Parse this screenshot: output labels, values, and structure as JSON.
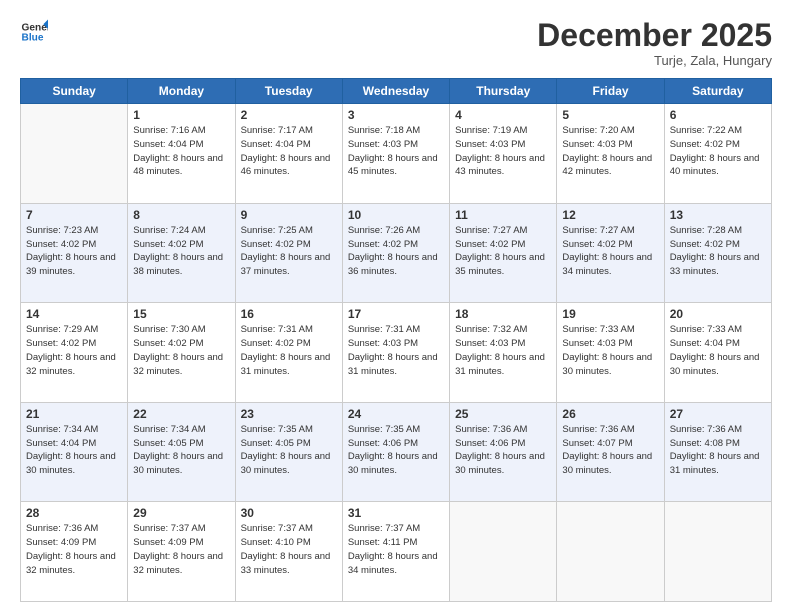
{
  "header": {
    "logo_line1": "General",
    "logo_line2": "Blue",
    "month": "December 2025",
    "location": "Turje, Zala, Hungary"
  },
  "weekdays": [
    "Sunday",
    "Monday",
    "Tuesday",
    "Wednesday",
    "Thursday",
    "Friday",
    "Saturday"
  ],
  "weeks": [
    [
      {
        "day": "",
        "sunrise": "",
        "sunset": "",
        "daylight": ""
      },
      {
        "day": "1",
        "sunrise": "7:16 AM",
        "sunset": "4:04 PM",
        "daylight": "8 hours and 48 minutes."
      },
      {
        "day": "2",
        "sunrise": "7:17 AM",
        "sunset": "4:04 PM",
        "daylight": "8 hours and 46 minutes."
      },
      {
        "day": "3",
        "sunrise": "7:18 AM",
        "sunset": "4:03 PM",
        "daylight": "8 hours and 45 minutes."
      },
      {
        "day": "4",
        "sunrise": "7:19 AM",
        "sunset": "4:03 PM",
        "daylight": "8 hours and 43 minutes."
      },
      {
        "day": "5",
        "sunrise": "7:20 AM",
        "sunset": "4:03 PM",
        "daylight": "8 hours and 42 minutes."
      },
      {
        "day": "6",
        "sunrise": "7:22 AM",
        "sunset": "4:02 PM",
        "daylight": "8 hours and 40 minutes."
      }
    ],
    [
      {
        "day": "7",
        "sunrise": "7:23 AM",
        "sunset": "4:02 PM",
        "daylight": "8 hours and 39 minutes."
      },
      {
        "day": "8",
        "sunrise": "7:24 AM",
        "sunset": "4:02 PM",
        "daylight": "8 hours and 38 minutes."
      },
      {
        "day": "9",
        "sunrise": "7:25 AM",
        "sunset": "4:02 PM",
        "daylight": "8 hours and 37 minutes."
      },
      {
        "day": "10",
        "sunrise": "7:26 AM",
        "sunset": "4:02 PM",
        "daylight": "8 hours and 36 minutes."
      },
      {
        "day": "11",
        "sunrise": "7:27 AM",
        "sunset": "4:02 PM",
        "daylight": "8 hours and 35 minutes."
      },
      {
        "day": "12",
        "sunrise": "7:27 AM",
        "sunset": "4:02 PM",
        "daylight": "8 hours and 34 minutes."
      },
      {
        "day": "13",
        "sunrise": "7:28 AM",
        "sunset": "4:02 PM",
        "daylight": "8 hours and 33 minutes."
      }
    ],
    [
      {
        "day": "14",
        "sunrise": "7:29 AM",
        "sunset": "4:02 PM",
        "daylight": "8 hours and 32 minutes."
      },
      {
        "day": "15",
        "sunrise": "7:30 AM",
        "sunset": "4:02 PM",
        "daylight": "8 hours and 32 minutes."
      },
      {
        "day": "16",
        "sunrise": "7:31 AM",
        "sunset": "4:02 PM",
        "daylight": "8 hours and 31 minutes."
      },
      {
        "day": "17",
        "sunrise": "7:31 AM",
        "sunset": "4:03 PM",
        "daylight": "8 hours and 31 minutes."
      },
      {
        "day": "18",
        "sunrise": "7:32 AM",
        "sunset": "4:03 PM",
        "daylight": "8 hours and 31 minutes."
      },
      {
        "day": "19",
        "sunrise": "7:33 AM",
        "sunset": "4:03 PM",
        "daylight": "8 hours and 30 minutes."
      },
      {
        "day": "20",
        "sunrise": "7:33 AM",
        "sunset": "4:04 PM",
        "daylight": "8 hours and 30 minutes."
      }
    ],
    [
      {
        "day": "21",
        "sunrise": "7:34 AM",
        "sunset": "4:04 PM",
        "daylight": "8 hours and 30 minutes."
      },
      {
        "day": "22",
        "sunrise": "7:34 AM",
        "sunset": "4:05 PM",
        "daylight": "8 hours and 30 minutes."
      },
      {
        "day": "23",
        "sunrise": "7:35 AM",
        "sunset": "4:05 PM",
        "daylight": "8 hours and 30 minutes."
      },
      {
        "day": "24",
        "sunrise": "7:35 AM",
        "sunset": "4:06 PM",
        "daylight": "8 hours and 30 minutes."
      },
      {
        "day": "25",
        "sunrise": "7:36 AM",
        "sunset": "4:06 PM",
        "daylight": "8 hours and 30 minutes."
      },
      {
        "day": "26",
        "sunrise": "7:36 AM",
        "sunset": "4:07 PM",
        "daylight": "8 hours and 30 minutes."
      },
      {
        "day": "27",
        "sunrise": "7:36 AM",
        "sunset": "4:08 PM",
        "daylight": "8 hours and 31 minutes."
      }
    ],
    [
      {
        "day": "28",
        "sunrise": "7:36 AM",
        "sunset": "4:09 PM",
        "daylight": "8 hours and 32 minutes."
      },
      {
        "day": "29",
        "sunrise": "7:37 AM",
        "sunset": "4:09 PM",
        "daylight": "8 hours and 32 minutes."
      },
      {
        "day": "30",
        "sunrise": "7:37 AM",
        "sunset": "4:10 PM",
        "daylight": "8 hours and 33 minutes."
      },
      {
        "day": "31",
        "sunrise": "7:37 AM",
        "sunset": "4:11 PM",
        "daylight": "8 hours and 34 minutes."
      },
      {
        "day": "",
        "sunrise": "",
        "sunset": "",
        "daylight": ""
      },
      {
        "day": "",
        "sunrise": "",
        "sunset": "",
        "daylight": ""
      },
      {
        "day": "",
        "sunrise": "",
        "sunset": "",
        "daylight": ""
      }
    ]
  ]
}
